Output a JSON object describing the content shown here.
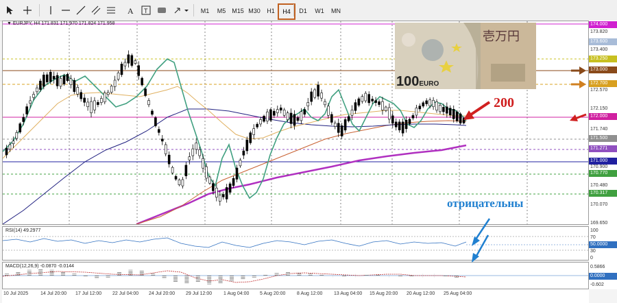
{
  "toolbar": {
    "timeframes": [
      "M1",
      "M5",
      "M15",
      "M30",
      "H1",
      "H4",
      "D1",
      "W1",
      "MN"
    ],
    "active_timeframe": "H4"
  },
  "chart": {
    "header": "▼ EURJPY, H4  171.831 171.970 171.824 171.958",
    "price_levels": [
      "173.820",
      "173.600",
      "173.400",
      "173.250",
      "173.000",
      "172.700",
      "172.570",
      "172.150",
      "172.000",
      "171.740",
      "171.500",
      "171.271",
      "171.000",
      "170.900",
      "170.770",
      "170.480",
      "170.317",
      "170.070",
      "169.650"
    ],
    "tagged_levels": [
      {
        "value": "174.000",
        "color": "#d020d0"
      },
      {
        "value": "173.600",
        "color": "#a8bcd8"
      },
      {
        "value": "173.250",
        "color": "#c8c020"
      },
      {
        "value": "173.000",
        "color": "#8a4a1a"
      },
      {
        "value": "172.700",
        "color": "#d8a020"
      },
      {
        "value": "172.000",
        "color": "#d020a0"
      },
      {
        "value": "171.500",
        "color": "#909090"
      },
      {
        "value": "171.271",
        "color": "#9050c0"
      },
      {
        "value": "171.000",
        "color": "#2020a0"
      },
      {
        "value": "170.770",
        "color": "#40a040"
      },
      {
        "value": "170.317",
        "color": "#40a040"
      }
    ],
    "annotation_200": "200",
    "annotation_negative": "отрицательны",
    "banknote_label": "100 EURO",
    "banknote_yen_text": "壱万円"
  },
  "rsi": {
    "header": "RSI(14) 49.2977",
    "levels": [
      "100",
      "70",
      "50.0000",
      "30",
      "0"
    ]
  },
  "macd": {
    "header": "MACD(12,26,9) -0.0870 -0.0144",
    "levels": [
      "0.5866",
      "0.0000",
      "-0.602"
    ]
  },
  "time_axis": [
    "10 Jul 2025",
    "14 Jul 20:00",
    "17 Jul 12:00",
    "22 Jul 04:00",
    "24 Jul 20:00",
    "29 Jul 12:00",
    "1 Aug 04:00",
    "5 Aug 20:00",
    "8 Aug 12:00",
    "13 Aug 04:00",
    "15 Aug 20:00",
    "20 Aug 12:00",
    "25 Aug 04:00"
  ]
}
